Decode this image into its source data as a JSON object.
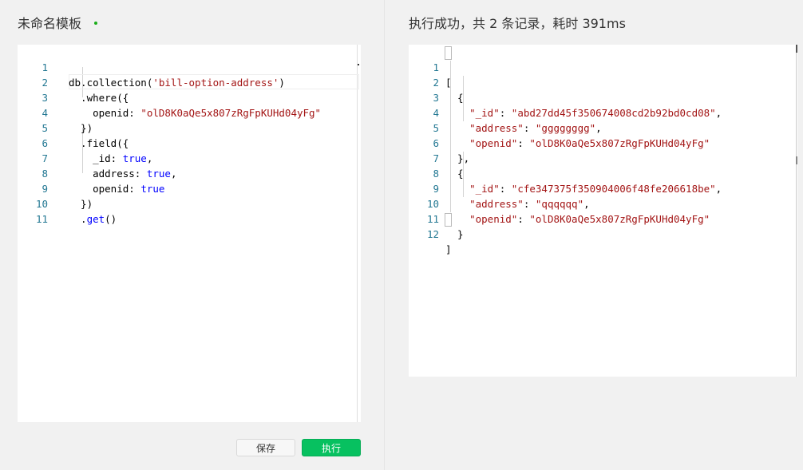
{
  "left": {
    "title": "未命名模板",
    "editor_lines": [
      {
        "n": "1"
      },
      {
        "n": "2"
      },
      {
        "n": "3"
      },
      {
        "n": "4"
      },
      {
        "n": "5"
      },
      {
        "n": "6"
      },
      {
        "n": "7"
      },
      {
        "n": "8"
      },
      {
        "n": "9"
      },
      {
        "n": "10"
      },
      {
        "n": "11"
      }
    ],
    "code": {
      "l1a": "db.collection(",
      "l1b": "'bill-option-address'",
      "l1c": ")",
      "l2": "  .where({",
      "l3a": "    openid: ",
      "l3b": "\"olD8K0aQe5x807zRgFpKUHd04yFg\"",
      "l4": "  })",
      "l5": "  .field({",
      "l6a": "    _id: ",
      "l6b": "true",
      "l6c": ",",
      "l7a": "    address: ",
      "l7b": "true",
      "l7c": ",",
      "l8a": "    openid: ",
      "l8b": "true",
      "l9": "  })",
      "l10a": "  .",
      "l10b": "get",
      "l10c": "()"
    },
    "buttons": {
      "save": "保存",
      "run": "执行"
    }
  },
  "right": {
    "title": "执行成功，共 2 条记录，耗时 391ms",
    "editor_lines": [
      {
        "n": "1"
      },
      {
        "n": "2"
      },
      {
        "n": "3"
      },
      {
        "n": "4"
      },
      {
        "n": "5"
      },
      {
        "n": "6"
      },
      {
        "n": "7"
      },
      {
        "n": "8"
      },
      {
        "n": "9"
      },
      {
        "n": "10"
      },
      {
        "n": "11"
      },
      {
        "n": "12"
      }
    ],
    "json": {
      "l1": "[",
      "l2": "  {",
      "l3k": "    \"_id\"",
      "l3s": ": ",
      "l3v": "\"abd27dd45f350674008cd2b92bd0cd08\"",
      "l3e": ",",
      "l4k": "    \"address\"",
      "l4s": ": ",
      "l4v": "\"gggggggg\"",
      "l4e": ",",
      "l5k": "    \"openid\"",
      "l5s": ": ",
      "l5v": "\"olD8K0aQe5x807zRgFpKUHd04yFg\"",
      "l6": "  },",
      "l7": "  {",
      "l8k": "    \"_id\"",
      "l8s": ": ",
      "l8v": "\"cfe347375f350904006f48fe206618be\"",
      "l8e": ",",
      "l9k": "    \"address\"",
      "l9s": ": ",
      "l9v": "\"qqqqqq\"",
      "l9e": ",",
      "l10k": "    \"openid\"",
      "l10s": ": ",
      "l10v": "\"olD8K0aQe5x807zRgFpKUHd04yFg\"",
      "l11": "  }",
      "l12": "]"
    }
  },
  "colors": {
    "run_button": "#07c160",
    "unsaved_dot": "#1aad19",
    "string": "#a31515",
    "keyword": "#0000ff",
    "line_number": "#237893"
  }
}
